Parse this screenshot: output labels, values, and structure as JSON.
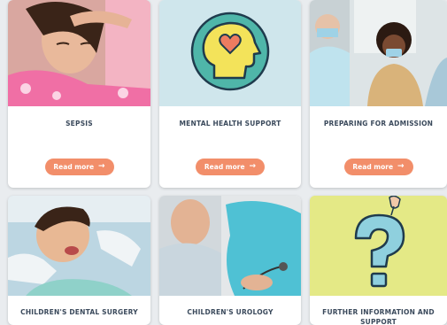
{
  "cards": [
    {
      "title": "SEPSIS",
      "button": "Read more",
      "arrow": "→"
    },
    {
      "title": "MENTAL HEALTH SUPPORT",
      "button": "Read more",
      "arrow": "→"
    },
    {
      "title": "PREPARING FOR ADMISSION",
      "button": "Read more",
      "arrow": "→"
    },
    {
      "title": "CHILDREN'S DENTAL SURGERY"
    },
    {
      "title": "CHILDREN'S UROLOGY"
    },
    {
      "title": "FURTHER INFORMATION AND SUPPORT"
    }
  ],
  "colors": {
    "button_bg": "#f28e6a",
    "title_text": "#3b4a5c",
    "mental_health_bg": "#cfe6ec",
    "further_info_bg": "#e4e986"
  },
  "icons": {
    "mental_health": "head-with-heart-icon",
    "further_info": "question-mark-icon"
  }
}
